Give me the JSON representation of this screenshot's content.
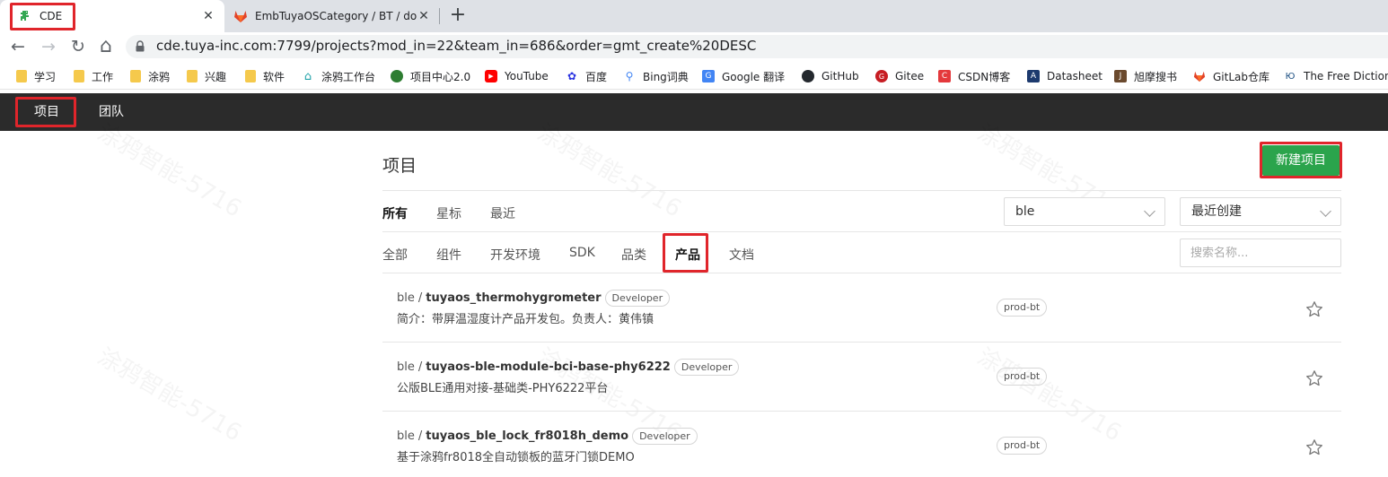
{
  "browser": {
    "tabs": [
      {
        "title": "CDE",
        "active": true,
        "icon": "dinosaur-icon"
      },
      {
        "title": "EmbTuyaOSCategory / BT / do",
        "active": false,
        "icon": "gitlab-icon"
      }
    ],
    "close_glyph": "✕",
    "new_tab_glyph": "+",
    "back_glyph": "←",
    "forward_glyph": "→",
    "reload_glyph": "↻",
    "home_glyph": "⌂",
    "url": "cde.tuya-inc.com:7799/projects?mod_in=22&team_in=686&order=gmt_create%20DESC",
    "bookmarks": [
      {
        "label": "学习",
        "icon": "folder-icon"
      },
      {
        "label": "工作",
        "icon": "folder-icon"
      },
      {
        "label": "涂鸦",
        "icon": "folder-icon"
      },
      {
        "label": "兴趣",
        "icon": "folder-icon"
      },
      {
        "label": "软件",
        "icon": "folder-icon"
      },
      {
        "label": "涂鸦工作台",
        "icon": "house-icon"
      },
      {
        "label": "项目中心2.0",
        "icon": "turtle-icon"
      },
      {
        "label": "YouTube",
        "icon": "youtube-icon"
      },
      {
        "label": "百度",
        "icon": "baidu-paw-icon"
      },
      {
        "label": "Bing词典",
        "icon": "search-icon"
      },
      {
        "label": "Google 翻译",
        "icon": "google-translate-icon"
      },
      {
        "label": "GitHub",
        "icon": "github-icon"
      },
      {
        "label": "Gitee",
        "icon": "gitee-icon"
      },
      {
        "label": "CSDN博客",
        "icon": "csdn-icon"
      },
      {
        "label": "Datasheet",
        "icon": "datasheet-icon"
      },
      {
        "label": "旭摩搜书",
        "icon": "book-j-icon"
      },
      {
        "label": "GitLab仓库",
        "icon": "gitlab-icon"
      },
      {
        "label": "The Free Diction",
        "icon": "dictionary-icon"
      }
    ],
    "colors": {
      "highlight_box": "#e0252b"
    }
  },
  "app": {
    "nav": [
      {
        "label": "项目",
        "active": true
      },
      {
        "label": "团队",
        "active": false
      }
    ]
  },
  "page": {
    "title": "项目",
    "new_button": "新建项目",
    "filters": [
      {
        "label": "所有",
        "active": true
      },
      {
        "label": "星标",
        "active": false
      },
      {
        "label": "最近",
        "active": false
      }
    ],
    "group_select": "ble",
    "sort_select": "最近创建",
    "categories": [
      {
        "label": "全部",
        "active": false
      },
      {
        "label": "组件",
        "active": false
      },
      {
        "label": "开发环境",
        "active": false
      },
      {
        "label": "SDK",
        "active": false
      },
      {
        "label": "品类",
        "active": false
      },
      {
        "label": "产品",
        "active": true
      },
      {
        "label": "文档",
        "active": false
      }
    ],
    "search_placeholder": "搜索名称...",
    "watermark": "涂鸦智能-5716"
  },
  "projects": [
    {
      "namespace": "ble",
      "name": "tuyaos_thermohygrometer",
      "role": "Developer",
      "description": "简介：带屏温湿度计产品开发包。负责人：黄伟镇",
      "tag": "prod-bt"
    },
    {
      "namespace": "ble",
      "name": "tuyaos-ble-module-bci-base-phy6222",
      "role": "Developer",
      "description": "公版BLE通用对接-基础类-PHY6222平台",
      "tag": "prod-bt"
    },
    {
      "namespace": "ble",
      "name": "tuyaos_ble_lock_fr8018h_demo",
      "role": "Developer",
      "description": "基于涂鸦fr8018全自动锁板的蓝牙门锁DEMO",
      "tag": "prod-bt"
    }
  ]
}
